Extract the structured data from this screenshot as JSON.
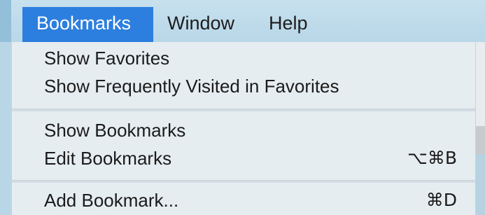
{
  "menubar": {
    "items": [
      {
        "label": "Bookmarks",
        "active": true
      },
      {
        "label": "Window",
        "active": false
      },
      {
        "label": "Help",
        "active": false
      }
    ]
  },
  "dropdown": {
    "items": [
      {
        "label": "Show Favorites",
        "shortcut": ""
      },
      {
        "label": "Show Frequently Visited in Favorites",
        "shortcut": ""
      },
      {
        "label": "Show Bookmarks",
        "shortcut": ""
      },
      {
        "label": "Edit Bookmarks",
        "shortcut": "⌥⌘B"
      },
      {
        "label": "Add Bookmark...",
        "shortcut": "⌘D"
      }
    ]
  },
  "colors": {
    "menubar_bg": "#b8d7e8",
    "active_highlight": "#2c7fde",
    "dropdown_bg": "#e6edf1"
  }
}
